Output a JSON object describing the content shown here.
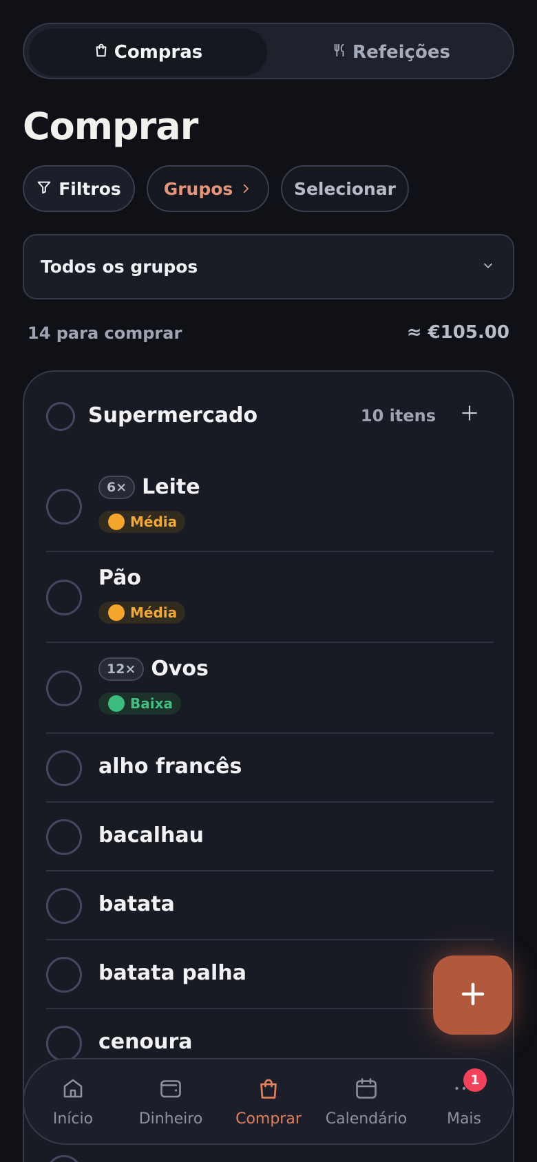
{
  "segmented": {
    "compras_label": "Compras",
    "refeicoes_label": "Refeições"
  },
  "page": {
    "title": "Comprar"
  },
  "chips": {
    "filters": "Filtros",
    "groups": "Grupos",
    "select": "Selecionar"
  },
  "group_select": {
    "value": "Todos os grupos"
  },
  "summary": {
    "count": "14 para comprar",
    "total": "≈ €105.00"
  },
  "group": {
    "name": "Supermercado",
    "count": "10 itens",
    "items": [
      {
        "name": "Leite",
        "qty": "6×",
        "priority": "Média"
      },
      {
        "name": "Pão",
        "qty": "",
        "priority": "Média"
      },
      {
        "name": "Ovos",
        "qty": "12×",
        "priority": "Baixa"
      },
      {
        "name": "alho francês",
        "qty": "",
        "priority": ""
      },
      {
        "name": "bacalhau",
        "qty": "",
        "priority": ""
      },
      {
        "name": "batata",
        "qty": "",
        "priority": ""
      },
      {
        "name": "batata palha",
        "qty": "",
        "priority": ""
      },
      {
        "name": "cenoura",
        "qty": "",
        "priority": ""
      }
    ]
  },
  "nav": {
    "items": [
      {
        "label": "Início",
        "icon": "home-icon"
      },
      {
        "label": "Dinheiro",
        "icon": "wallet-icon"
      },
      {
        "label": "Comprar",
        "icon": "shopping-bag-icon"
      },
      {
        "label": "Calendário",
        "icon": "calendar-icon"
      },
      {
        "label": "Mais",
        "icon": "more-icon"
      }
    ],
    "mais_badge": "1"
  },
  "colors": {
    "accent": "#e0805e",
    "fab": "#b2583c",
    "priority_medium": "#f4a52b",
    "priority_low": "#3dbd7d"
  }
}
